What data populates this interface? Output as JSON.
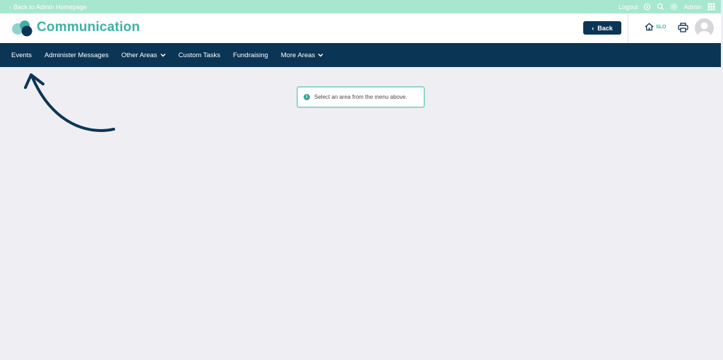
{
  "topbar": {
    "back_label": "Back to Admin Homepage",
    "logout_label": "Logout",
    "admin_label": "Admin"
  },
  "header": {
    "title": "Communication",
    "back_button_label": "Back",
    "school_code": "SLO"
  },
  "nav": {
    "items": [
      {
        "label": "Events",
        "dropdown": false
      },
      {
        "label": "Administer Messages",
        "dropdown": false
      },
      {
        "label": "Other Areas",
        "dropdown": true
      },
      {
        "label": "Custom Tasks",
        "dropdown": false
      },
      {
        "label": "Fundraising",
        "dropdown": false
      },
      {
        "label": "More Areas",
        "dropdown": true
      }
    ]
  },
  "main": {
    "info_message": "Select an area from the menu above."
  },
  "colors": {
    "topbar": "#a7e6cf",
    "accent": "#3bb3a5",
    "navy": "#0b3555",
    "background": "#efeef3"
  },
  "icons": [
    "chevron-left-icon",
    "logout-icon",
    "search-icon",
    "gear-icon",
    "apps-grid-icon",
    "home-icon",
    "print-icon",
    "avatar-icon",
    "info-icon",
    "chevron-down-icon",
    "annotation-arrow"
  ]
}
